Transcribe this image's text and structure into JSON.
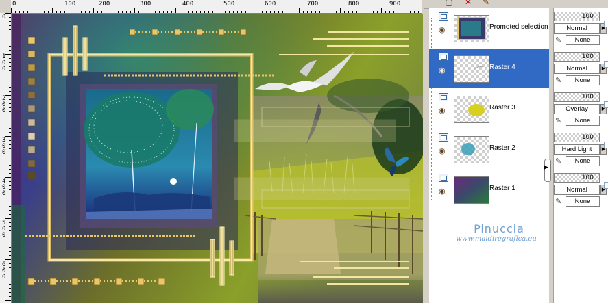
{
  "ruler": {
    "top_labels": [
      "0",
      "100",
      "200",
      "300",
      "400",
      "500",
      "600",
      "700",
      "800",
      "900"
    ],
    "left_labels": [
      "0",
      "1\n0\n0",
      "2\n0\n0",
      "3\n0\n0",
      "4\n0\n0",
      "5\n0\n0",
      "6\n0\n0"
    ]
  },
  "artwork": {
    "subject": "digital collage with tree, seagulls, boardwalk and butterfly",
    "colors": {
      "accent_gold": "#e6c76a",
      "background_purple": "#5a1e6a",
      "background_green": "#7c9a2a"
    }
  },
  "palette_toolbar": {
    "icons": [
      "new-layer-icon",
      "delete-icon",
      "paint-icon"
    ]
  },
  "layers": [
    {
      "name": "Promoted selection",
      "selected": false,
      "opacity": "100",
      "blend": "Normal",
      "mask": "None",
      "opacity_fraction": 1.0
    },
    {
      "name": "Raster 4",
      "selected": true,
      "opacity": "100",
      "blend": "Normal",
      "mask": "None",
      "opacity_fraction": 1.0
    },
    {
      "name": "Raster 3",
      "selected": false,
      "opacity": "100",
      "blend": "Overlay",
      "mask": "None",
      "opacity_fraction": 1.0
    },
    {
      "name": "Raster 2",
      "selected": false,
      "opacity": "100",
      "blend": "Hard Light",
      "mask": "None",
      "opacity_fraction": 1.0
    },
    {
      "name": "Raster 1",
      "selected": false,
      "opacity": "100",
      "blend": "Normal",
      "mask": "None",
      "opacity_fraction": 1.0
    }
  ],
  "watermark": {
    "name": "Pinuccia",
    "url": "www.maidiregrafica.eu"
  }
}
